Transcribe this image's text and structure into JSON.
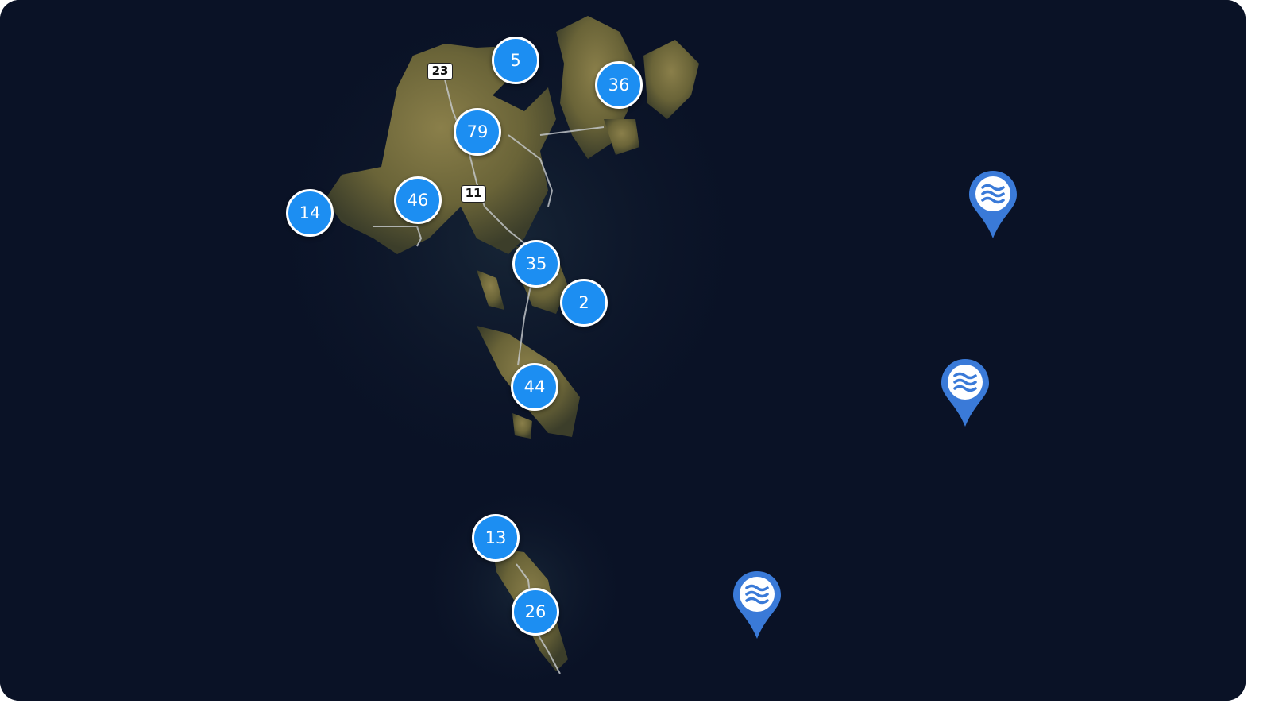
{
  "map": {
    "clusters": [
      {
        "id": "cluster-5",
        "count": "5"
      },
      {
        "id": "cluster-36",
        "count": "36"
      },
      {
        "id": "cluster-79",
        "count": "79"
      },
      {
        "id": "cluster-46",
        "count": "46"
      },
      {
        "id": "cluster-14",
        "count": "14"
      },
      {
        "id": "cluster-35",
        "count": "35"
      },
      {
        "id": "cluster-2",
        "count": "2"
      },
      {
        "id": "cluster-44",
        "count": "44"
      },
      {
        "id": "cluster-13",
        "count": "13"
      },
      {
        "id": "cluster-26",
        "count": "26"
      }
    ],
    "road_shields": [
      {
        "id": "road-23",
        "label": "23"
      },
      {
        "id": "road-11",
        "label": "11"
      }
    ],
    "water_pins": [
      {
        "id": "water-pin-1",
        "icon": "waves-icon"
      },
      {
        "id": "water-pin-2",
        "icon": "waves-icon"
      },
      {
        "id": "water-pin-3",
        "icon": "waves-icon"
      }
    ],
    "colors": {
      "ocean": "#0a1226",
      "cluster_fill": "#1c8ef2",
      "cluster_border": "#ffffff",
      "pin_fill": "#3a7ad8",
      "land": "#6e6a3e"
    }
  }
}
